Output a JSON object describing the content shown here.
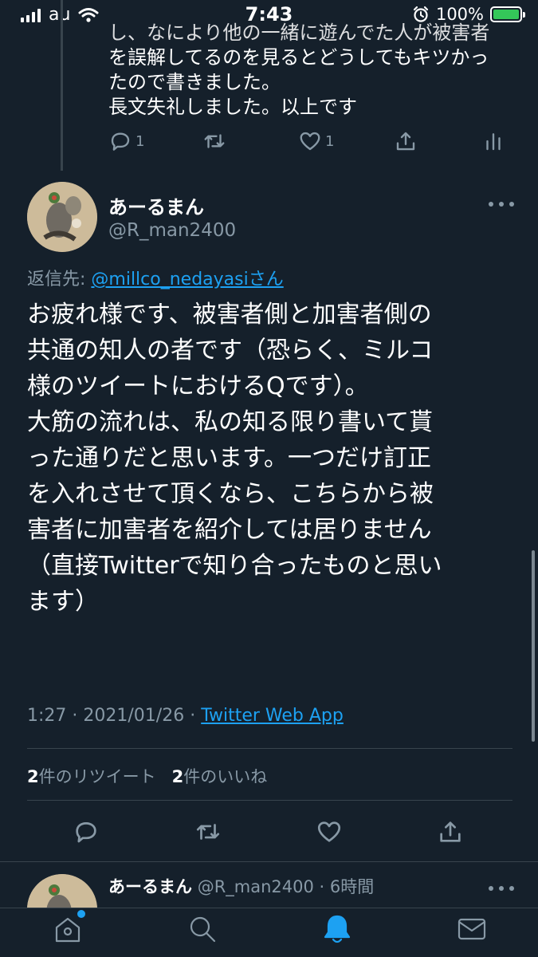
{
  "status_bar": {
    "carrier": "au",
    "time": "7:43",
    "battery": "100%",
    "battery_level": 1.0
  },
  "previous_tweet": {
    "lines": [
      "し、なにより他の一緒に遊んでた人が被害者",
      "を誤解してるのを見るとどうしてもキツかっ",
      "たので書きました。",
      "長文失礼しました。以上です"
    ],
    "reply_count": "1",
    "like_count": "1"
  },
  "tweet": {
    "author_name": "あーるまん",
    "author_handle": "@R_man2400",
    "reply_prefix": "返信先: ",
    "reply_mention": "@millco_nedayasiさん",
    "text_lines": [
      "お疲れ様です、被害者側と加害者側の",
      "共通の知人の者です（恐らく、ミルコ",
      "様のツイートにおけるQです）。",
      "大筋の流れは、私の知る限り書いて貰",
      "った通りだと思います。一つだけ訂正",
      "を入れさせて頂くなら、こちらから被",
      "害者に加害者を紹介しては居りません",
      "（直接Twitterで知り合ったものと思い",
      "ます）"
    ],
    "time": "1:27",
    "date": "2021/01/26",
    "source": "Twitter Web App",
    "retweet_count": "2",
    "retweet_label": "件のリツイート",
    "like_count": "2",
    "like_label": "件のいいね"
  },
  "next_tweet": {
    "author_name": "あーるまん",
    "author_handle": "@R_man2400",
    "time_ago": "6時間"
  },
  "colors": {
    "background": "#15202b",
    "secondary_text": "#8899a6",
    "link": "#1da1f2",
    "divider": "#38444d",
    "active_tab": "#1da1f2"
  },
  "nav": {
    "items": [
      "home-icon",
      "search-icon",
      "notifications-icon",
      "messages-icon"
    ],
    "active": "notifications-icon"
  }
}
